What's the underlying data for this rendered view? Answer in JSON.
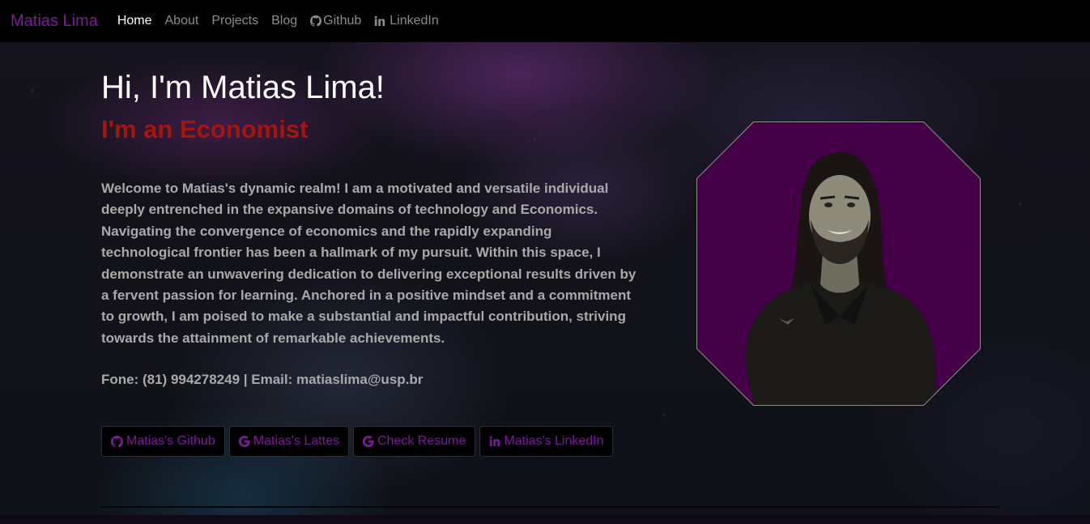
{
  "nav": {
    "brand": "Matias Lima",
    "links": [
      {
        "label": "Home",
        "active": true
      },
      {
        "label": "About"
      },
      {
        "label": "Projects"
      },
      {
        "label": "Blog"
      },
      {
        "label": "Github",
        "icon": "github-icon"
      },
      {
        "label": "LinkedIn",
        "icon": "linkedin-icon"
      }
    ]
  },
  "hero": {
    "title": "Hi, I'm Matias Lima!",
    "subtitle": "I'm an Economist",
    "bio": "Welcome to Matias's dynamic realm! I am a motivated and versatile individual deeply entrenched in the expansive domains of technology and Economics. Navigating the convergence of economics and the rapidly expanding technological frontier has been a hallmark of my pursuit. Within this space, I demonstrate an unwavering dedication to delivering exceptional results driven by a fervent passion for learning. Anchored in a positive mindset and a commitment to growth, I am poised to make a substantial and impactful contribution, striving towards the attainment of remarkable achievements.",
    "contact": "Fone: (81) 994278249 | Email: matiaslima@usp.br"
  },
  "buttons": [
    {
      "label": "Matias's Github",
      "icon": "github-icon"
    },
    {
      "label": "Matias's Lattes",
      "icon": "google-icon"
    },
    {
      "label": "Check Resume",
      "icon": "google-icon"
    },
    {
      "label": "Matias's LinkedIn",
      "icon": "linkedin-icon"
    }
  ],
  "colors": {
    "brand": "#7b1a9a",
    "subtitle": "#a3160f",
    "photo_bg": "#440046",
    "nav_bg": "#000000"
  }
}
